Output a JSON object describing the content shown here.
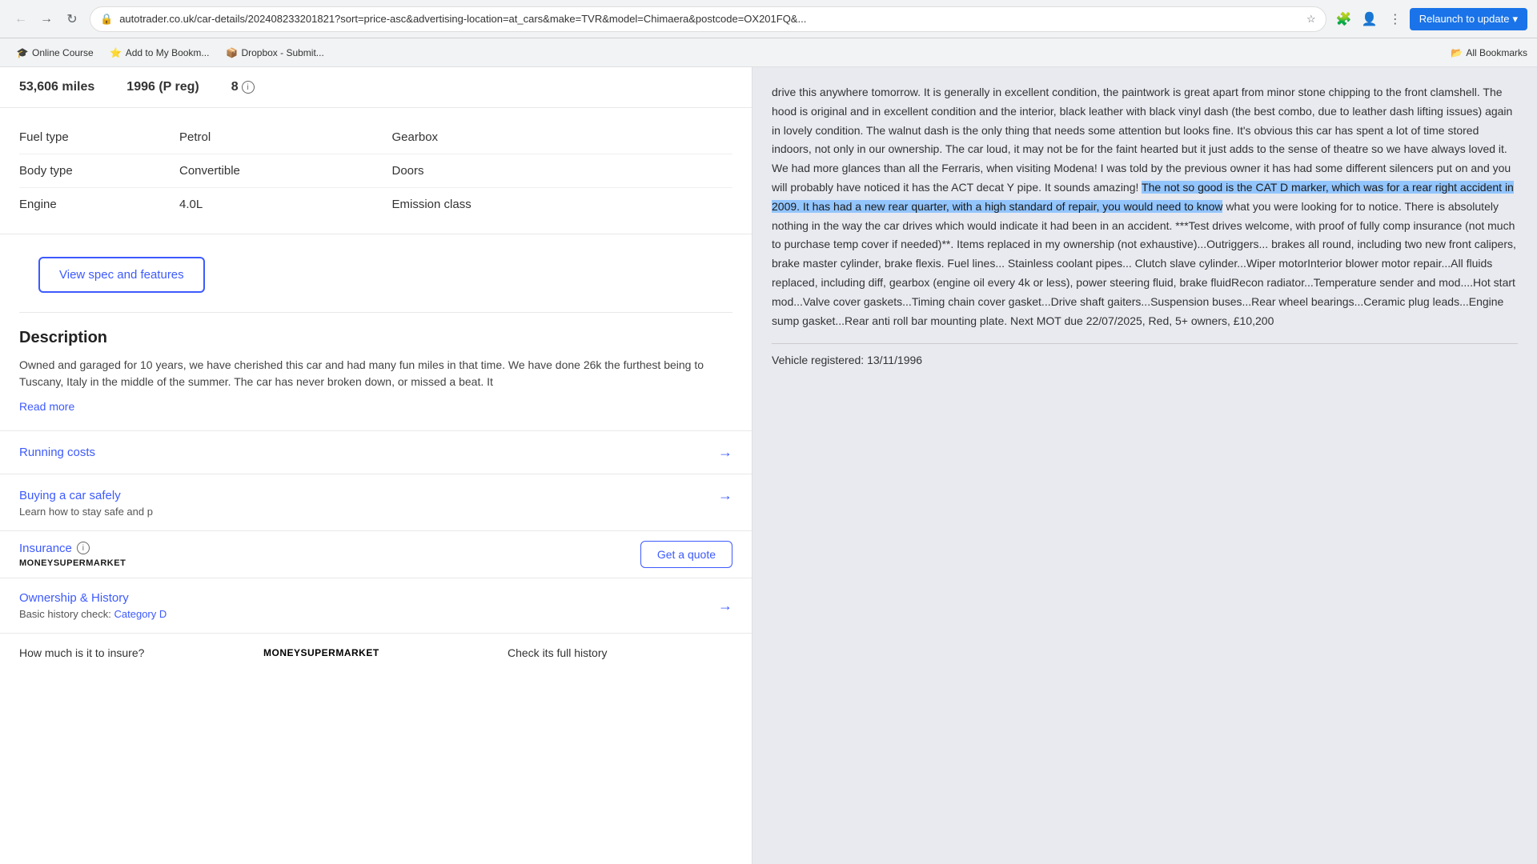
{
  "browser": {
    "url": "autotrader.co.uk/car-details/202408233201821?sort=price-asc&advertising-location=at_cars&make=TVR&model=Chimaera&postcode=OX201FQ&...",
    "relaunch_label": "Relaunch to update",
    "bookmarks": [
      {
        "label": "Online Course",
        "icon": "🎓"
      },
      {
        "label": "Add to My Bookm...",
        "icon": "⭐"
      },
      {
        "label": "Dropbox - Submit...",
        "icon": "📦"
      }
    ],
    "bookmarks_right_label": "All Bookmarks"
  },
  "page": {
    "stats": {
      "mileage": "53,606 miles",
      "year": "1996 (P reg)",
      "owners_count": "8",
      "owners_label": ""
    },
    "specs": [
      {
        "label": "Fuel type",
        "value": "Petrol",
        "label2": "Gearbox",
        "value2": ""
      },
      {
        "label": "Body type",
        "value": "Convertible",
        "label2": "Doors",
        "value2": ""
      },
      {
        "label": "Engine",
        "value": "4.0L",
        "label2": "Emission class",
        "value2": ""
      }
    ],
    "view_spec_btn": "View spec and features",
    "description": {
      "title": "Description",
      "text": "Owned and garaged for 10 years, we have cherished this car and had many fun miles in that time. We have done 26k the furthest being to Tuscany, Italy in the middle of the summer. The car has never broken down, or missed a beat. It",
      "read_more": "Read more"
    },
    "running_costs_label": "Running costs",
    "buying_safely": {
      "title": "Buying a car safely",
      "subtitle": "Learn how to stay safe and p"
    },
    "insurance": {
      "title": "Insurance",
      "logo": "MoneySuperMarket",
      "get_quote": "Get a quote"
    },
    "ownership": {
      "title": "Ownership & History",
      "subtitle": "Basic history check:",
      "category": "Category D"
    },
    "bottom_banner": {
      "insurance_q": "How much is it to insure?",
      "msm_logo": "MoneySuperMarket",
      "history_check": "Check its full history"
    }
  },
  "right_panel": {
    "text_before_highlight": "drive this anywhere tomorrow. It is generally in excellent condition, the paintwork is great apart from minor stone chipping to the front clamshell. The hood is original and in excellent condition and the interior, black leather with black vinyl dash (the best combo, due to leather dash lifting issues) again in lovely condition. The walnut dash is the only thing that needs some attention but looks fine. It's obvious this car has spent a lot of time stored indoors, not only in our ownership. The car loud, it may not be for the faint hearted but it just adds to the sense of theatre so we have always loved it. We had more glances than all the Ferraris, when visiting Modena! I was told by the previous owner it has had some different silencers put on and you will probably have noticed it has the ACT decat Y pipe. It sounds amazing! ",
    "highlighted": "The not so good is the CAT D marker, which was for a rear right accident in 2009. It has had a new rear quarter, with a high standard of repair, you would need to know",
    "text_after_highlight": " what you were looking for to notice. There is absolutely nothing in the way the car drives which would indicate it had been in an accident. ***Test drives welcome, with proof of fully comp insurance (not much to purchase temp cover if needed)**. Items replaced in my ownership (not exhaustive)...Outriggers... brakes all round, including two new front calipers, brake master cylinder, brake flexis. Fuel lines... Stainless coolant pipes... Clutch slave cylinder...Wiper motorInterior blower motor repair...All fluids replaced, including diff, gearbox (engine oil every 4k or less), power steering fluid, brake fluidRecon radiator...Temperature sender and mod....Hot start mod...Valve cover gaskets...Timing chain cover gasket...Drive shaft gaiters...Suspension buses...Rear wheel bearings...Ceramic plug leads...Engine sump gasket...Rear anti roll bar mounting plate. Next MOT due 22/07/2025, Red, 5+ owners, £10,200",
    "vehicle_registered": "Vehicle registered: 13/11/1996"
  }
}
